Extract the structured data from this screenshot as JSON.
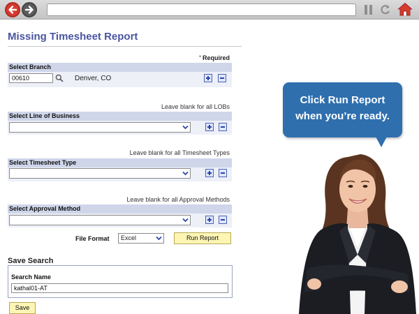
{
  "browser": {
    "back_icon": "back-arrow-icon",
    "forward_icon": "forward-arrow-icon",
    "url": "",
    "pause_icon": "pause-icon",
    "refresh_icon": "refresh-icon",
    "home_icon": "home-icon",
    "accent_color": "#d63a2e"
  },
  "page": {
    "title": "Missing Timesheet Report",
    "required_note": "' Required",
    "title_color": "#4a55a0"
  },
  "branch": {
    "label": "Select Branch",
    "code": "00610",
    "name": "Denver, CO"
  },
  "line_of_business": {
    "hint": "Leave blank for all LOBs",
    "label": "Select Line of Business",
    "value": ""
  },
  "timesheet_type": {
    "hint": "Leave blank for all Timesheet Types",
    "label": "Select Timesheet Type",
    "value": ""
  },
  "approval_method": {
    "hint": "Leave blank for all Approval Methods",
    "label": "Select Approval Method",
    "value": ""
  },
  "file_format": {
    "label": "File Format",
    "selected": "Excel"
  },
  "run_report": {
    "label": "Run Report"
  },
  "save_search": {
    "title": "Save Search",
    "name_label": "Search Name",
    "name_value": "kathal01-AT",
    "save_label": "Save"
  },
  "callout": {
    "line1": "Click Run Report",
    "line2": "when you’re ready.",
    "color": "#2f6fae"
  }
}
